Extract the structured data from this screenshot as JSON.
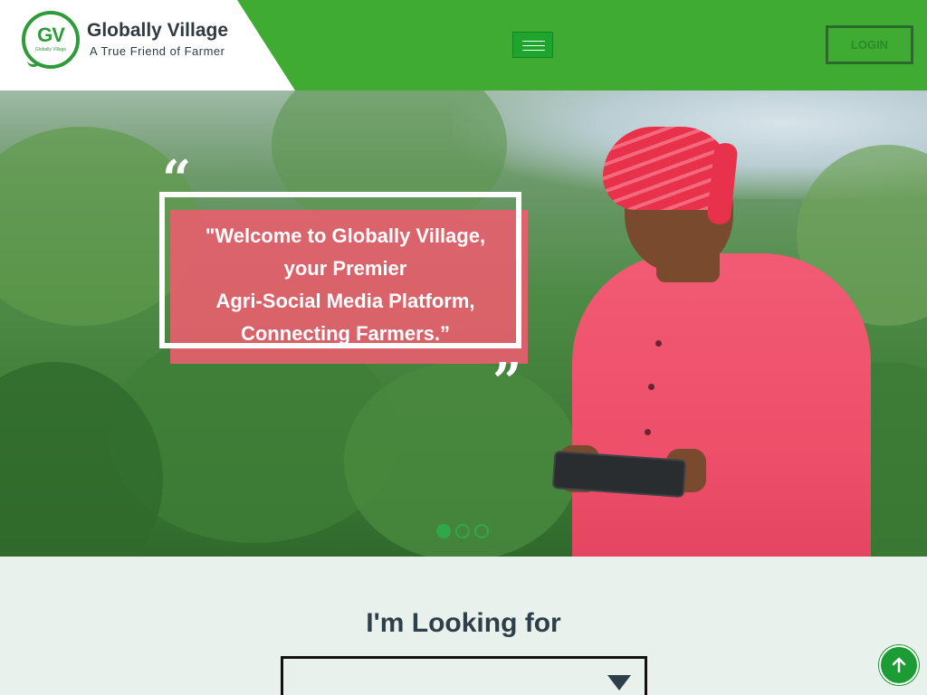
{
  "brand": {
    "logo_initials": "GV",
    "logo_small_text": "Globally Village",
    "name": "Globally Village",
    "tagline": "A True Friend of Farmer"
  },
  "header": {
    "menu_icon": "hamburger-icon",
    "login_label": "LOGIN",
    "background_color": "#3fab33"
  },
  "hero": {
    "quote_lines": [
      "\"Welcome to Globally Village,",
      "your Premier",
      "Agri-Social Media Platform,",
      "Connecting Farmers.”"
    ],
    "quote_open": "“",
    "quote_close": "”",
    "slides": [
      {
        "active": true
      },
      {
        "active": false
      },
      {
        "active": false
      }
    ],
    "quote_bg_color": "#e6606e"
  },
  "search": {
    "heading": "I'm Looking for",
    "selected_value": ""
  },
  "scroll_top": {
    "icon": "arrow-up-icon"
  }
}
